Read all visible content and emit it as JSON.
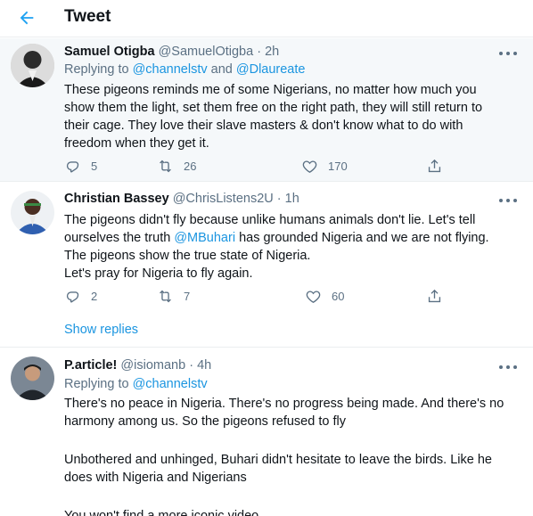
{
  "header": {
    "title": "Tweet",
    "back_icon": "arrow-left-icon",
    "accent": "#1da1f2"
  },
  "tweets": [
    {
      "name": "Samuel Otigba",
      "handle": "@SamuelOtigba",
      "sep": "·",
      "time": "2h",
      "replying_prefix": "Replying to ",
      "replying_a": "@channelstv",
      "replying_and": " and ",
      "replying_b": "@Dlaureate",
      "lines": [
        "These pigeons reminds me of some Nigerians, no matter how much you",
        "show them the light, set them free on the right path, they will still return to",
        "their cage. They love their slave masters & don't know what to do with",
        "freedom when they get it."
      ],
      "replies": "5",
      "retweets": "26",
      "likes": "170"
    },
    {
      "name": "Christian Bassey",
      "handle": "@ChrisListens2U",
      "sep": "·",
      "time": "1h",
      "line1": "The pigeons didn't fly because unlike humans animals don't lie. Let's tell",
      "line2_pre": "ourselves the truth ",
      "line2_mention": "@MBuhari",
      "line2_post": " has grounded Nigeria and we are not flying.",
      "line3": "The pigeons show the true state of Nigeria.",
      "line4": "Let's pray for Nigeria to fly again.",
      "replies": "2",
      "retweets": "7",
      "likes": "60",
      "show_replies": "Show replies"
    },
    {
      "name": "P.article!",
      "handle": "@isiomanb",
      "sep": "·",
      "time": "4h",
      "replying_prefix": "Replying to ",
      "replying_a": "@channelstv",
      "lines": [
        "There's no peace in Nigeria. There's no progress being made. And there's no",
        "harmony among us. So the pigeons refused to fly",
        "",
        "Unbothered and unhinged, Buhari didn't hesitate to leave the birds. Like he",
        "does with Nigeria and Nigerians",
        "",
        "You won't find a more iconic video"
      ]
    }
  ]
}
